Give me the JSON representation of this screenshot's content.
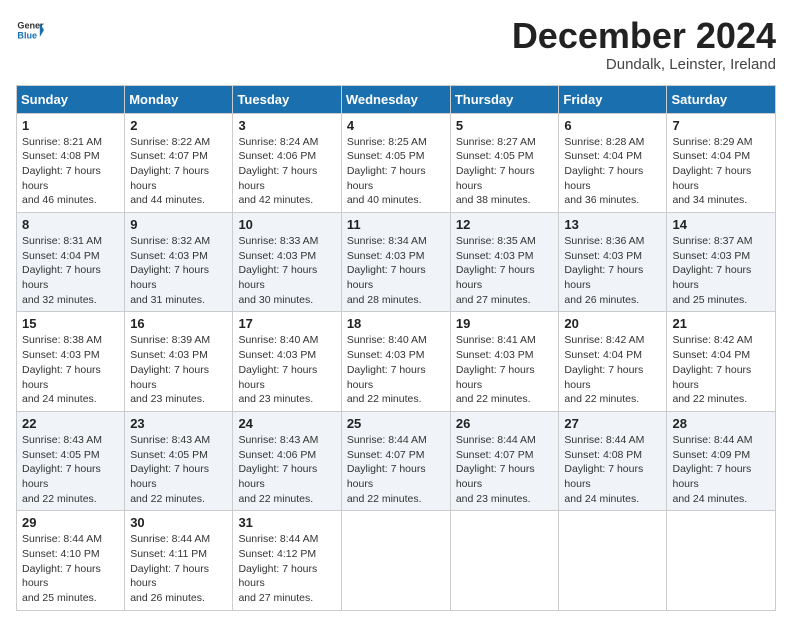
{
  "header": {
    "logo_general": "General",
    "logo_blue": "Blue",
    "month_title": "December 2024",
    "subtitle": "Dundalk, Leinster, Ireland"
  },
  "weekdays": [
    "Sunday",
    "Monday",
    "Tuesday",
    "Wednesday",
    "Thursday",
    "Friday",
    "Saturday"
  ],
  "weeks": [
    [
      {
        "day": "1",
        "sunrise": "8:21 AM",
        "sunset": "4:08 PM",
        "daylight": "7 hours and 46 minutes."
      },
      {
        "day": "2",
        "sunrise": "8:22 AM",
        "sunset": "4:07 PM",
        "daylight": "7 hours and 44 minutes."
      },
      {
        "day": "3",
        "sunrise": "8:24 AM",
        "sunset": "4:06 PM",
        "daylight": "7 hours and 42 minutes."
      },
      {
        "day": "4",
        "sunrise": "8:25 AM",
        "sunset": "4:05 PM",
        "daylight": "7 hours and 40 minutes."
      },
      {
        "day": "5",
        "sunrise": "8:27 AM",
        "sunset": "4:05 PM",
        "daylight": "7 hours and 38 minutes."
      },
      {
        "day": "6",
        "sunrise": "8:28 AM",
        "sunset": "4:04 PM",
        "daylight": "7 hours and 36 minutes."
      },
      {
        "day": "7",
        "sunrise": "8:29 AM",
        "sunset": "4:04 PM",
        "daylight": "7 hours and 34 minutes."
      }
    ],
    [
      {
        "day": "8",
        "sunrise": "8:31 AM",
        "sunset": "4:04 PM",
        "daylight": "7 hours and 32 minutes."
      },
      {
        "day": "9",
        "sunrise": "8:32 AM",
        "sunset": "4:03 PM",
        "daylight": "7 hours and 31 minutes."
      },
      {
        "day": "10",
        "sunrise": "8:33 AM",
        "sunset": "4:03 PM",
        "daylight": "7 hours and 30 minutes."
      },
      {
        "day": "11",
        "sunrise": "8:34 AM",
        "sunset": "4:03 PM",
        "daylight": "7 hours and 28 minutes."
      },
      {
        "day": "12",
        "sunrise": "8:35 AM",
        "sunset": "4:03 PM",
        "daylight": "7 hours and 27 minutes."
      },
      {
        "day": "13",
        "sunrise": "8:36 AM",
        "sunset": "4:03 PM",
        "daylight": "7 hours and 26 minutes."
      },
      {
        "day": "14",
        "sunrise": "8:37 AM",
        "sunset": "4:03 PM",
        "daylight": "7 hours and 25 minutes."
      }
    ],
    [
      {
        "day": "15",
        "sunrise": "8:38 AM",
        "sunset": "4:03 PM",
        "daylight": "7 hours and 24 minutes."
      },
      {
        "day": "16",
        "sunrise": "8:39 AM",
        "sunset": "4:03 PM",
        "daylight": "7 hours and 23 minutes."
      },
      {
        "day": "17",
        "sunrise": "8:40 AM",
        "sunset": "4:03 PM",
        "daylight": "7 hours and 23 minutes."
      },
      {
        "day": "18",
        "sunrise": "8:40 AM",
        "sunset": "4:03 PM",
        "daylight": "7 hours and 22 minutes."
      },
      {
        "day": "19",
        "sunrise": "8:41 AM",
        "sunset": "4:03 PM",
        "daylight": "7 hours and 22 minutes."
      },
      {
        "day": "20",
        "sunrise": "8:42 AM",
        "sunset": "4:04 PM",
        "daylight": "7 hours and 22 minutes."
      },
      {
        "day": "21",
        "sunrise": "8:42 AM",
        "sunset": "4:04 PM",
        "daylight": "7 hours and 22 minutes."
      }
    ],
    [
      {
        "day": "22",
        "sunrise": "8:43 AM",
        "sunset": "4:05 PM",
        "daylight": "7 hours and 22 minutes."
      },
      {
        "day": "23",
        "sunrise": "8:43 AM",
        "sunset": "4:05 PM",
        "daylight": "7 hours and 22 minutes."
      },
      {
        "day": "24",
        "sunrise": "8:43 AM",
        "sunset": "4:06 PM",
        "daylight": "7 hours and 22 minutes."
      },
      {
        "day": "25",
        "sunrise": "8:44 AM",
        "sunset": "4:07 PM",
        "daylight": "7 hours and 22 minutes."
      },
      {
        "day": "26",
        "sunrise": "8:44 AM",
        "sunset": "4:07 PM",
        "daylight": "7 hours and 23 minutes."
      },
      {
        "day": "27",
        "sunrise": "8:44 AM",
        "sunset": "4:08 PM",
        "daylight": "7 hours and 24 minutes."
      },
      {
        "day": "28",
        "sunrise": "8:44 AM",
        "sunset": "4:09 PM",
        "daylight": "7 hours and 24 minutes."
      }
    ],
    [
      {
        "day": "29",
        "sunrise": "8:44 AM",
        "sunset": "4:10 PM",
        "daylight": "7 hours and 25 minutes."
      },
      {
        "day": "30",
        "sunrise": "8:44 AM",
        "sunset": "4:11 PM",
        "daylight": "7 hours and 26 minutes."
      },
      {
        "day": "31",
        "sunrise": "8:44 AM",
        "sunset": "4:12 PM",
        "daylight": "7 hours and 27 minutes."
      },
      null,
      null,
      null,
      null
    ]
  ]
}
